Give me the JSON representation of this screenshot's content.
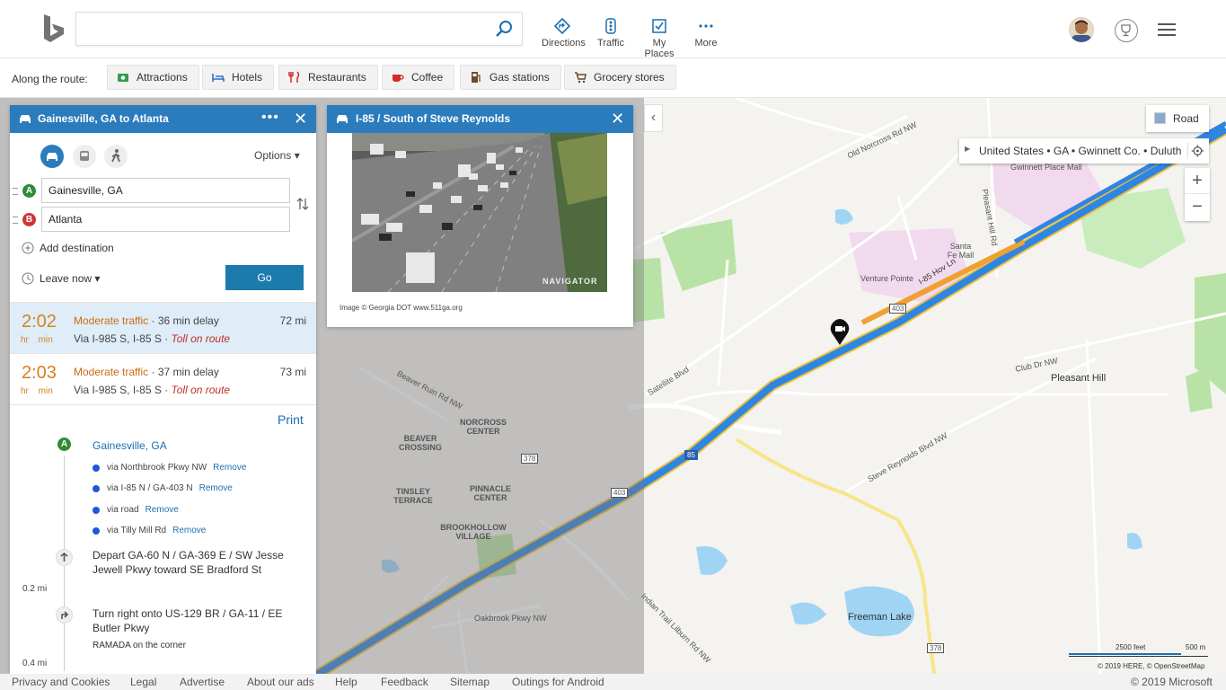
{
  "header": {
    "search_value": "",
    "nav": [
      {
        "label": "Directions",
        "icon": "directions-icon"
      },
      {
        "label": "Traffic",
        "icon": "traffic-icon"
      },
      {
        "label": "My Places",
        "icon": "my-places-icon"
      },
      {
        "label": "More",
        "icon": "more-icon"
      }
    ]
  },
  "route_bar": {
    "label": "Along the route:",
    "chips": [
      "Attractions",
      "Hotels",
      "Restaurants",
      "Coffee",
      "Gas stations",
      "Grocery stores"
    ]
  },
  "directions": {
    "title": "Gainesville, GA to Atlanta",
    "options_label": "Options",
    "from": "Gainesville, GA",
    "to": "Atlanta",
    "from_badge": "A",
    "to_badge": "B",
    "add_destination": "Add destination",
    "leave_now": "Leave now",
    "go": "Go",
    "routes": [
      {
        "time": "2:02",
        "units": "hr min",
        "traffic": "Moderate traffic",
        "delay": " · 36 min delay",
        "via": "Via I-985 S, I-85 S · ",
        "toll": "Toll on route",
        "distance": "72 mi"
      },
      {
        "time": "2:03",
        "units": "hr min",
        "traffic": "Moderate traffic",
        "delay": " · 37 min delay",
        "via": "Via I-985 S, I-85 S · ",
        "toll": "Toll on route",
        "distance": "73 mi"
      }
    ],
    "print": "Print",
    "start_label": "Gainesville, GA",
    "via_points": [
      {
        "text": "via Northbrook Pkwy NW",
        "remove": "Remove"
      },
      {
        "text": "via I-85 N / GA-403 N",
        "remove": "Remove"
      },
      {
        "text": "via road",
        "remove": "Remove"
      },
      {
        "text": "via Tilly Mill Rd",
        "remove": "Remove"
      }
    ],
    "steps": [
      {
        "text": "Depart GA-60 N / GA-369 E / SW Jesse Jewell Pkwy toward SE Bradford St",
        "distance": "0.2 mi"
      },
      {
        "text": "Turn right onto US-129 BR / GA-11 / EE Butler Pkwy",
        "note": "RAMADA on the corner",
        "distance": "0.4 mi"
      }
    ]
  },
  "camera": {
    "title": "I-85 / South of Steve Reynolds",
    "credit": "Image © Georgia DOT www.511ga.org",
    "watermark": "NAVIGATOR"
  },
  "map": {
    "road_button": "Road",
    "breadcrumb": "United States • GA • Gwinnett Co. • Duluth",
    "scale_feet": "2500 feet",
    "scale_m": "500 m",
    "attribution": "© 2019 HERE, © OpenStreetMap",
    "labels": {
      "pleasant_hill": "Pleasant Hill",
      "venture_pointe": "Venture Pointe",
      "santa_fe_mall": "Santa Fe Mall",
      "gwinnett_place": "Gwinnett Place Mall",
      "freeman_lake": "Freeman Lake",
      "norcross_center": "NORCROSS CENTER",
      "beaver_crossing": "BEAVER CROSSING",
      "tinsley_terrace": "TINSLEY TERRACE",
      "pinnacle_center": "PINNACLE CENTER",
      "brookhollow_village": "BROOKHOLLOW VILLAGE",
      "club_dr": "Club Dr NW",
      "old_norcross": "Old Norcross Rd NW",
      "satellite": "Satellite Blvd",
      "beaver_ruin": "Beaver Ruin Rd NW",
      "steve_reynolds": "Steve Reynolds Blvd NW",
      "pleasant_hill_rd": "Pleasant Hill Rd",
      "oakbrook": "Oakbrook Pkwy NW",
      "indian_trail": "Indian Trail Lilburn Rd NW",
      "i85_hov": "I-85 Hov Ln",
      "shield_403": "403",
      "shield_85": "85",
      "shield_378": "378"
    }
  },
  "footer": {
    "links": [
      "Privacy and Cookies",
      "Legal",
      "Advertise",
      "About our ads",
      "Help",
      "Feedback",
      "Sitemap",
      "Outings for Android"
    ],
    "copyright": "© 2019 Microsoft"
  }
}
